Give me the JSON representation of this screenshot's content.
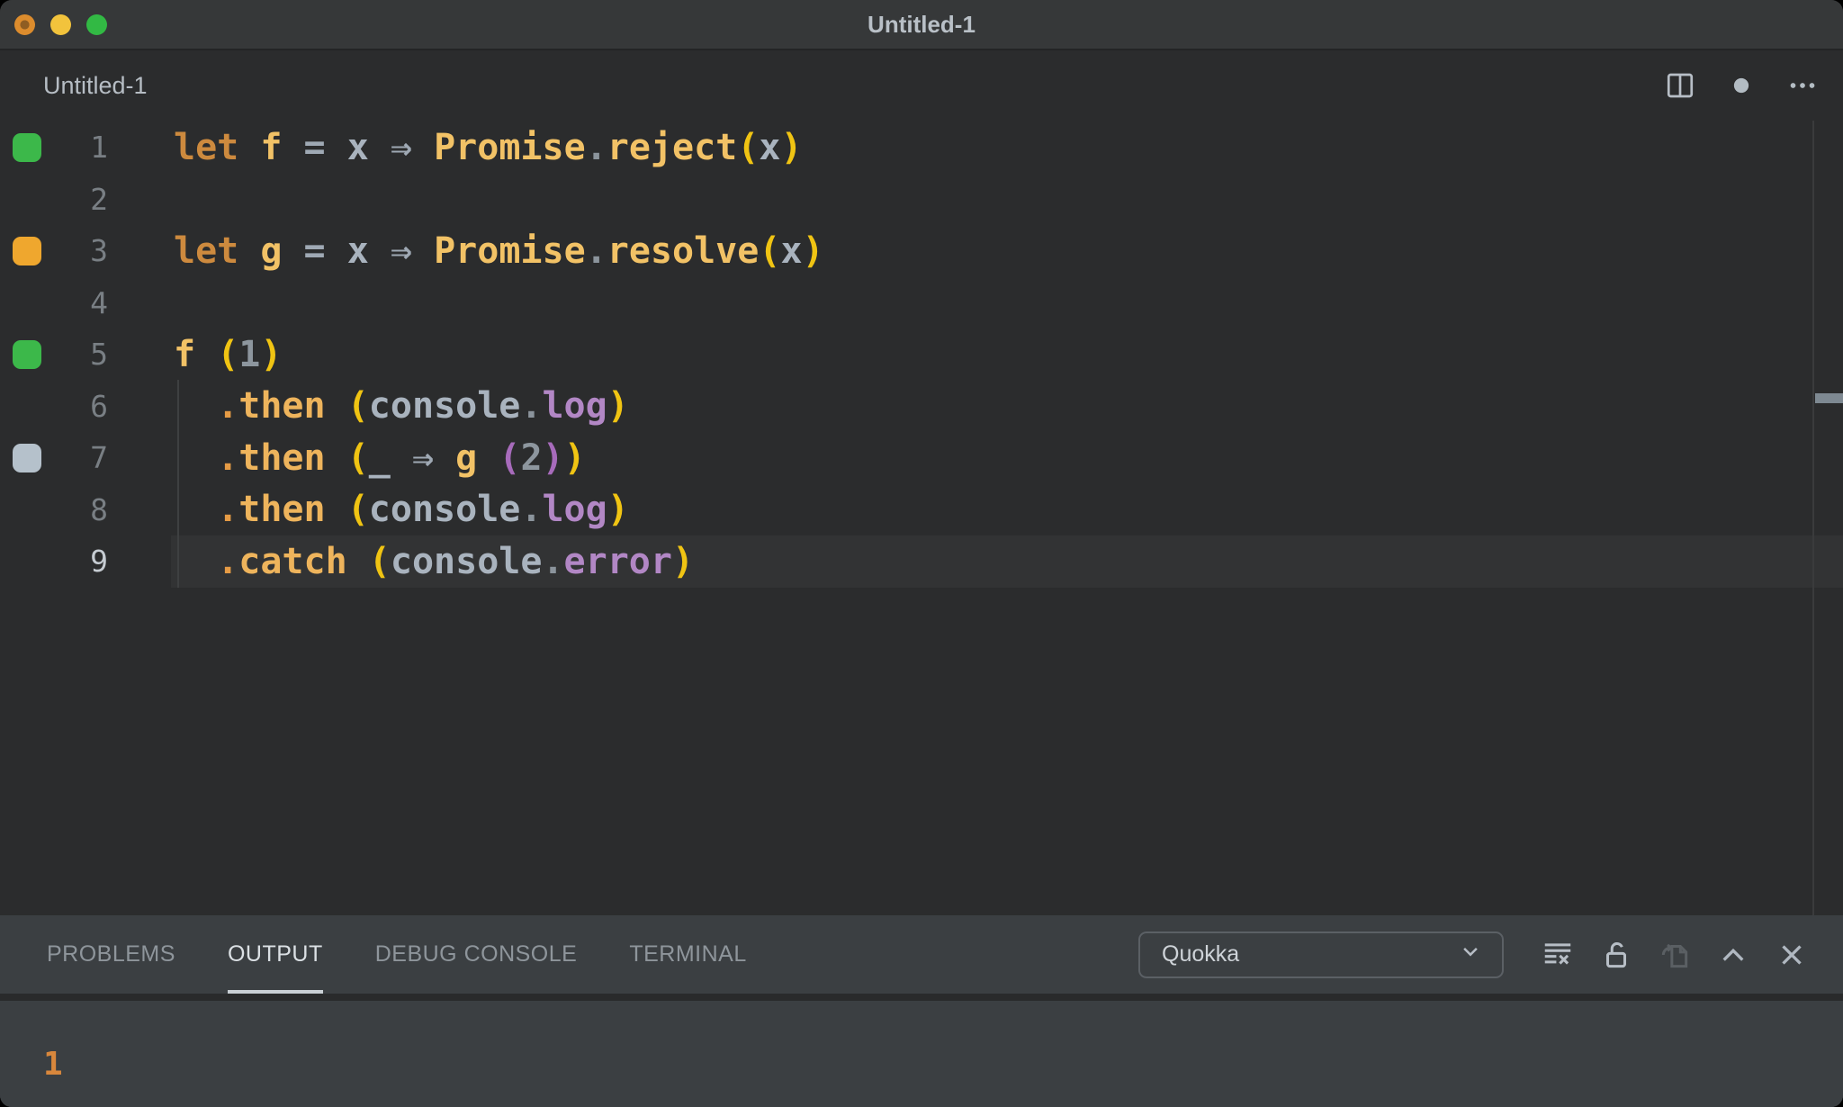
{
  "window": {
    "title": "Untitled-1",
    "traffic_lights": [
      {
        "name": "close",
        "color": "#dc8c2d",
        "inner_dot": "#8f5d22"
      },
      {
        "name": "minimize",
        "color": "#f2c33c"
      },
      {
        "name": "zoom",
        "color": "#32b944"
      }
    ]
  },
  "editor": {
    "tab_title": "Untitled-1",
    "actions": [
      "split-editor",
      "unsaved-dot",
      "more-actions"
    ],
    "lines": [
      {
        "num": "1",
        "marker": "green",
        "current": false,
        "tokens": [
          [
            "let",
            "kw"
          ],
          [
            " ",
            "ws"
          ],
          [
            "f",
            "id"
          ],
          [
            " ",
            "ws"
          ],
          [
            "=",
            "op"
          ],
          [
            " ",
            "ws"
          ],
          [
            "x",
            "var"
          ],
          [
            " ",
            "ws"
          ],
          [
            "⇒",
            "op"
          ],
          [
            " ",
            "ws"
          ],
          [
            "Promise",
            "id"
          ],
          [
            ".",
            "punct"
          ],
          [
            "reject",
            "id"
          ],
          [
            "(",
            "p1"
          ],
          [
            "x",
            "var"
          ],
          [
            ")",
            "p1"
          ]
        ]
      },
      {
        "num": "2",
        "marker": null,
        "current": false,
        "tokens": []
      },
      {
        "num": "3",
        "marker": "orange",
        "current": false,
        "tokens": [
          [
            "let",
            "kw"
          ],
          [
            " ",
            "ws"
          ],
          [
            "g",
            "id"
          ],
          [
            " ",
            "ws"
          ],
          [
            "=",
            "op"
          ],
          [
            " ",
            "ws"
          ],
          [
            "x",
            "var"
          ],
          [
            " ",
            "ws"
          ],
          [
            "⇒",
            "op"
          ],
          [
            " ",
            "ws"
          ],
          [
            "Promise",
            "id"
          ],
          [
            ".",
            "punct"
          ],
          [
            "resolve",
            "id"
          ],
          [
            "(",
            "p1"
          ],
          [
            "x",
            "var"
          ],
          [
            ")",
            "p1"
          ]
        ]
      },
      {
        "num": "4",
        "marker": null,
        "current": false,
        "tokens": []
      },
      {
        "num": "5",
        "marker": "green",
        "current": false,
        "tokens": [
          [
            "f",
            "id"
          ],
          [
            " ",
            "ws"
          ],
          [
            "(",
            "p1"
          ],
          [
            "1",
            "num"
          ],
          [
            ")",
            "p1"
          ]
        ]
      },
      {
        "num": "6",
        "marker": null,
        "current": false,
        "tokens": [
          [
            "  ",
            "ws"
          ],
          [
            ".",
            "dot"
          ],
          [
            "then",
            "meth"
          ],
          [
            " ",
            "ws"
          ],
          [
            "(",
            "p1"
          ],
          [
            "console",
            "var"
          ],
          [
            ".",
            "punct"
          ],
          [
            "log",
            "prop"
          ],
          [
            ")",
            "p1"
          ]
        ]
      },
      {
        "num": "7",
        "marker": "gray",
        "current": false,
        "tokens": [
          [
            "  ",
            "ws"
          ],
          [
            ".",
            "dot"
          ],
          [
            "then",
            "meth"
          ],
          [
            " ",
            "ws"
          ],
          [
            "(",
            "p1"
          ],
          [
            "_",
            "var"
          ],
          [
            " ",
            "ws"
          ],
          [
            "⇒",
            "op"
          ],
          [
            " ",
            "ws"
          ],
          [
            "g",
            "id"
          ],
          [
            " ",
            "ws"
          ],
          [
            "(",
            "p2"
          ],
          [
            "2",
            "num"
          ],
          [
            ")",
            "p2"
          ],
          [
            ")",
            "p1"
          ]
        ]
      },
      {
        "num": "8",
        "marker": null,
        "current": false,
        "tokens": [
          [
            "  ",
            "ws"
          ],
          [
            ".",
            "dot"
          ],
          [
            "then",
            "meth"
          ],
          [
            " ",
            "ws"
          ],
          [
            "(",
            "p1"
          ],
          [
            "console",
            "var"
          ],
          [
            ".",
            "punct"
          ],
          [
            "log",
            "prop"
          ],
          [
            ")",
            "p1"
          ]
        ]
      },
      {
        "num": "9",
        "marker": null,
        "current": true,
        "tokens": [
          [
            "  ",
            "ws"
          ],
          [
            ".",
            "dot"
          ],
          [
            "catch",
            "meth"
          ],
          [
            " ",
            "ws"
          ],
          [
            "(",
            "p1"
          ],
          [
            "console",
            "var"
          ],
          [
            ".",
            "punct"
          ],
          [
            "error",
            "prop"
          ],
          [
            ")",
            "p1"
          ]
        ]
      }
    ]
  },
  "panel": {
    "tabs": [
      {
        "label": "PROBLEMS",
        "active": false
      },
      {
        "label": "OUTPUT",
        "active": true
      },
      {
        "label": "DEBUG CONSOLE",
        "active": false
      },
      {
        "label": "TERMINAL",
        "active": false
      }
    ],
    "channel_dropdown": {
      "value": "Quokka"
    },
    "actions": [
      "clear-output",
      "unlock",
      "open-log-file",
      "maximize-panel",
      "close-panel"
    ],
    "output_lines": [
      "1"
    ]
  },
  "colors": {
    "token": {
      "kw": "#cd8a3e",
      "id": "#f2c266",
      "meth": "#eeb45c",
      "dot": "#e59b45",
      "p1": "#f0c413",
      "p2": "#a76bbb",
      "op": "#9fa9b4",
      "var": "#a9b3be",
      "num": "#8d969e",
      "punct": "#8b949c",
      "prop": "#b287c5",
      "ws": "#a9b3be"
    },
    "marker": {
      "green": "#3cb84a",
      "orange": "#efa72e",
      "gray": "#b5c1cb"
    },
    "ui": {
      "editor_bg": "#2b2c2d",
      "panel_bg": "#3b3f42",
      "titlebar_bg": "#363839",
      "current_line_bg": "#323334",
      "output_text": "#d8873c",
      "icon": "#b7bec6",
      "icon_dim": "#5a5f63"
    }
  }
}
